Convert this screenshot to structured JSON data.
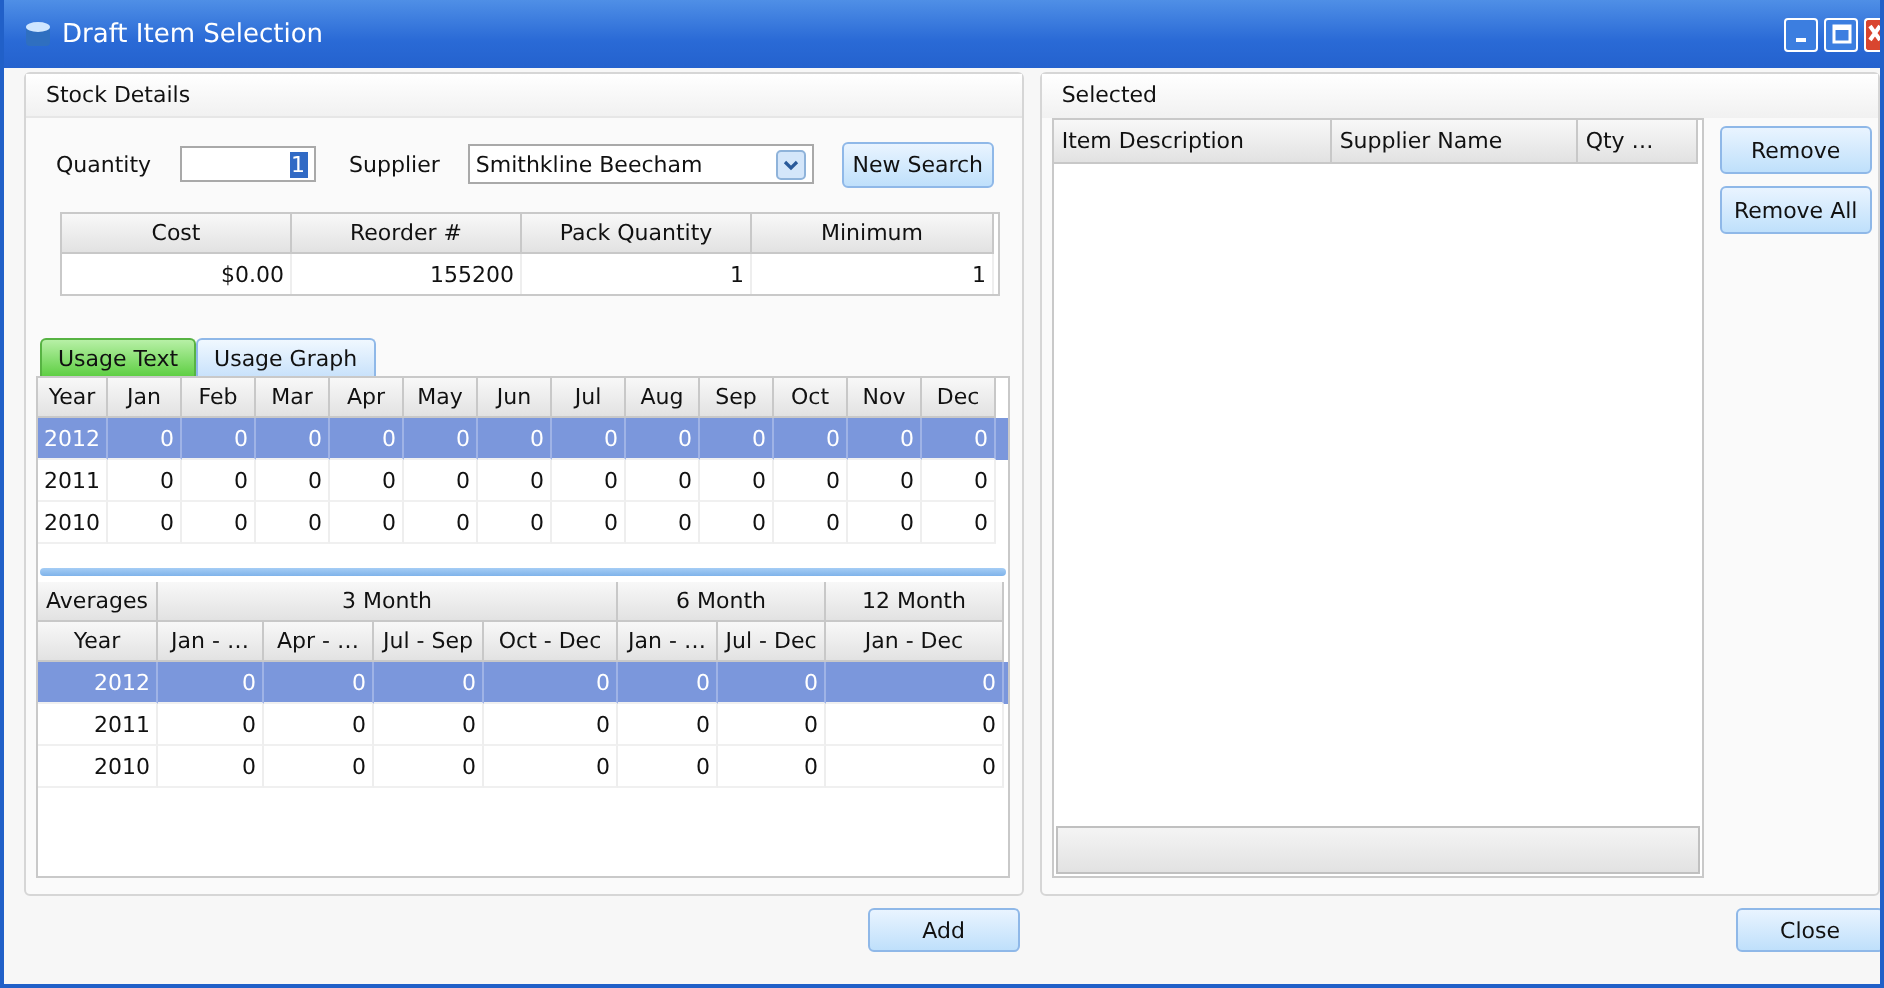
{
  "window": {
    "title": "Draft Item Selection"
  },
  "stock_details": {
    "title": "Stock Details",
    "quantity": {
      "label": "Quantity",
      "value": "1"
    },
    "supplier": {
      "label": "Supplier",
      "value": "Smithkline Beecham"
    },
    "new_search": "New Search",
    "stock_table": {
      "columns": [
        "Cost",
        "Reorder #",
        "Pack Quantity",
        "Minimum"
      ],
      "rows": [
        [
          "$0.00",
          "155200",
          "1",
          "1"
        ]
      ]
    },
    "tabs": [
      {
        "label": "Usage Text",
        "selected": true
      },
      {
        "label": "Usage Graph",
        "selected": false
      }
    ],
    "monthly_table": {
      "columns": [
        "Year",
        "Jan",
        "Feb",
        "Mar",
        "Apr",
        "May",
        "Jun",
        "Jul",
        "Aug",
        "Sep",
        "Oct",
        "Nov",
        "Dec"
      ],
      "rows": [
        {
          "selected": true,
          "cells": [
            "2012",
            "0",
            "0",
            "0",
            "0",
            "0",
            "0",
            "0",
            "0",
            "0",
            "0",
            "0",
            "0"
          ]
        },
        {
          "selected": false,
          "cells": [
            "2011",
            "0",
            "0",
            "0",
            "0",
            "0",
            "0",
            "0",
            "0",
            "0",
            "0",
            "0",
            "0"
          ]
        },
        {
          "selected": false,
          "cells": [
            "2010",
            "0",
            "0",
            "0",
            "0",
            "0",
            "0",
            "0",
            "0",
            "0",
            "0",
            "0",
            "0"
          ]
        }
      ]
    },
    "averages_table": {
      "groups": [
        {
          "label": "Averages",
          "columns": [
            "Year"
          ]
        },
        {
          "label": "3 Month",
          "columns": [
            "Jan - …",
            "Apr - …",
            "Jul - Sep",
            "Oct - Dec"
          ]
        },
        {
          "label": "6 Month",
          "columns": [
            "Jan - …",
            "Jul - Dec"
          ]
        },
        {
          "label": "12 Month",
          "columns": [
            "Jan - Dec"
          ]
        }
      ],
      "rows": [
        {
          "selected": true,
          "cells": [
            "2012",
            "0",
            "0",
            "0",
            "0",
            "0",
            "0",
            "0"
          ]
        },
        {
          "selected": false,
          "cells": [
            "2011",
            "0",
            "0",
            "0",
            "0",
            "0",
            "0",
            "0"
          ]
        },
        {
          "selected": false,
          "cells": [
            "2010",
            "0",
            "0",
            "0",
            "0",
            "0",
            "0",
            "0"
          ]
        }
      ]
    }
  },
  "add_button": "Add",
  "selected_panel": {
    "title": "Selected",
    "columns": [
      "Item Description",
      "Supplier Name",
      "Qty …"
    ],
    "buttons": [
      "Remove",
      "Remove All"
    ]
  },
  "close_button": "Close"
}
